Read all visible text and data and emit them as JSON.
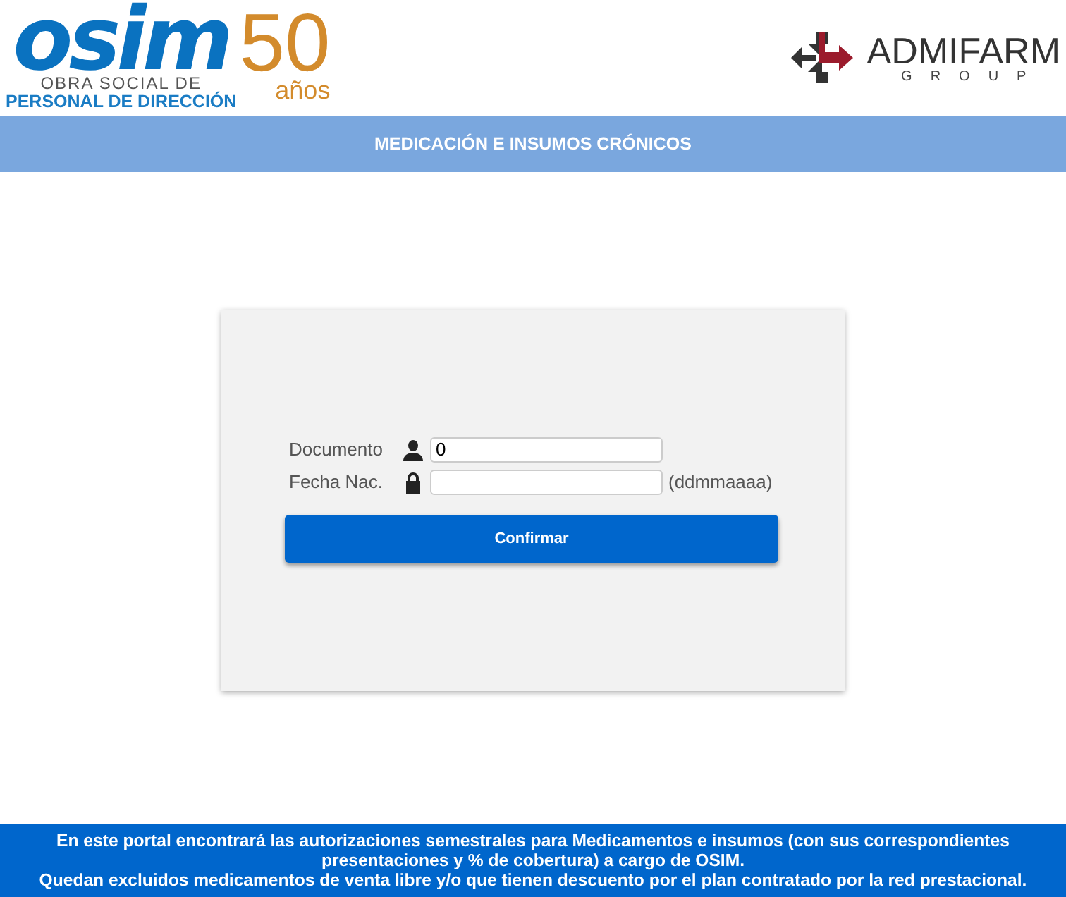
{
  "header": {
    "left_logo": {
      "mark": "osim",
      "anniversary": "50",
      "anniversary_word": "años",
      "line_1": "OBRA SOCIAL DE",
      "line_2": "PERSONAL DE DIRECCIÓN"
    },
    "right_logo": {
      "name": "ADMIFARM",
      "tagline": "GROUP"
    }
  },
  "title_bar": {
    "title": "MEDICACIÓN E INSUMOS CRÓNICOS"
  },
  "form": {
    "fields": [
      {
        "label": "Documento",
        "kind": "document",
        "value": "0"
      },
      {
        "label": "Fecha Nac.",
        "kind": "date",
        "hint": "(ddmmaaaa)"
      }
    ],
    "button": "Confirmar"
  },
  "footer": {
    "lines": [
      "En este portal encontrará las autorizaciones semestrales para Medicamentos e insumos (con sus correspondientes presentaciones y % de cobertura) a cargo de OSIM.",
      "Quedan excluidos medicamentos de venta libre y/o que tienen descuento por el plan contratado por la red prestacional."
    ]
  }
}
